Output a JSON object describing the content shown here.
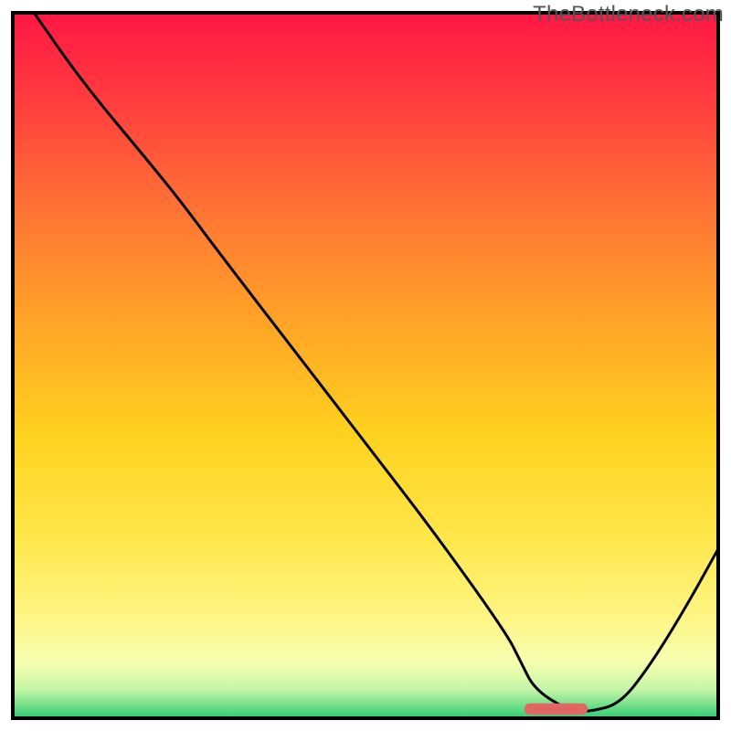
{
  "watermark": "TheBottleneck.com",
  "chart_data": {
    "type": "line",
    "title": "",
    "xlabel": "",
    "ylabel": "",
    "xlim": [
      0,
      100
    ],
    "ylim": [
      0,
      100
    ],
    "grid": false,
    "legend": false,
    "series": [
      {
        "name": "curve",
        "x": [
          3,
          10,
          20,
          24,
          30,
          40,
          50,
          60,
          70,
          72,
          74,
          79,
          80,
          82,
          86,
          90,
          95,
          100
        ],
        "y": [
          100,
          90,
          78,
          73,
          65,
          52,
          39,
          26,
          12,
          8,
          4,
          1,
          1,
          1,
          2,
          7,
          15,
          24
        ]
      }
    ],
    "marker": {
      "x_center": 77,
      "y": 1.3,
      "width": 9,
      "height": 1.6,
      "color": "#e06666"
    },
    "background_gradient": {
      "stops": [
        {
          "offset": 0.0,
          "color": "#ff1744"
        },
        {
          "offset": 0.12,
          "color": "#ff3b3f"
        },
        {
          "offset": 0.3,
          "color": "#ff7a33"
        },
        {
          "offset": 0.45,
          "color": "#ffa726"
        },
        {
          "offset": 0.6,
          "color": "#ffd21f"
        },
        {
          "offset": 0.75,
          "color": "#ffe74d"
        },
        {
          "offset": 0.85,
          "color": "#fff480"
        },
        {
          "offset": 0.92,
          "color": "#f7ffb0"
        },
        {
          "offset": 0.96,
          "color": "#c4f5a6"
        },
        {
          "offset": 1.0,
          "color": "#2ecc71"
        }
      ]
    },
    "frame": {
      "stroke": "#000000",
      "stroke_width": 4,
      "inset": 14
    },
    "curve_style": {
      "stroke": "#000000",
      "stroke_width": 3
    }
  }
}
